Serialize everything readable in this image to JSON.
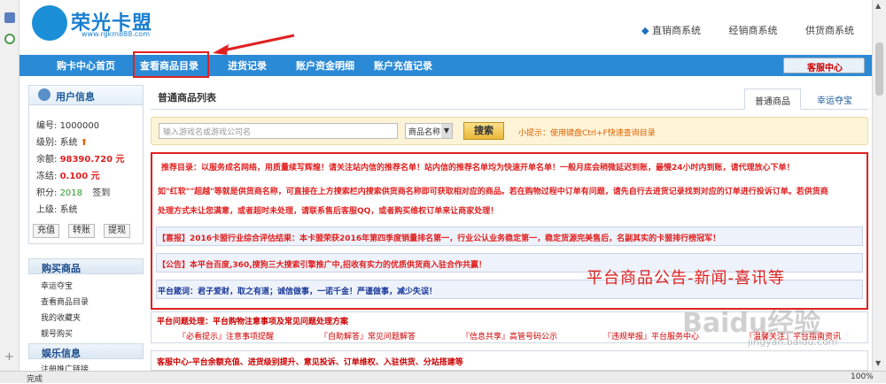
{
  "header": {
    "logo_text": "荣光卡盟",
    "logo_url": "www.rgkm888.com",
    "systems": [
      "直销商系统",
      "经销商系统",
      "供货商系统"
    ]
  },
  "nav": {
    "items": [
      "购卡中心首页",
      "查看商品目录",
      "进货记录",
      "账户资金明细",
      "账户充值记录"
    ],
    "customer_service": "客服中心"
  },
  "user": {
    "title": "用户信息",
    "id_label": "编号:",
    "id_value": "1000000",
    "level_label": "级别:",
    "level_value": "系统",
    "balance_label": "余额:",
    "balance_value": "98390.720 元",
    "frozen_label": "冻结:",
    "frozen_value": "0.100 元",
    "points_label": "积分:",
    "points_value": "2018",
    "checkin": "签到",
    "parent_label": "上级:",
    "parent_value": "系统",
    "buttons": [
      "充值",
      "转账",
      "提现"
    ]
  },
  "buy": {
    "title": "购买商品",
    "items": [
      "幸运夺宝",
      "查看商品目录",
      "我的收藏夹",
      "靓号购买"
    ]
  },
  "entertainment": {
    "title": "娱乐信息",
    "items": [
      "注册推广链接"
    ]
  },
  "content": {
    "list_title": "普通商品列表",
    "tabs": [
      "普通商品",
      "幸运夺宝"
    ],
    "search_placeholder": "输入游戏名或游戏公司名",
    "search_select": "商品名称",
    "search_button": "搜索",
    "search_tip": "小提示：使用键盘Ctrl+F快速查询目录"
  },
  "notice": {
    "line1": "推荐目录：以服务成名网络，用质量续写辉煌！请关注站内信的推荐名单！站内信的推荐名单均为快速开单名单！一般月底会稍微延迟到账，最慢24小时内到账，请代理放心下单！",
    "line2": "如\"红软\"\"超越\"等就是供货商名称，可直接在上方搜索栏内搜索供货商名称即可获取相对应的商品。若在购物过程中订单有问题，请先自行去进货记录找到对应的订单进行投诉订单。若供货商",
    "line3": "处理方式未让您满意，或者超时未处理，请联系售后客服QQ，或者购买维权订单来让商家处理！",
    "xibao": "【喜报】2016卡盟行业综合评估结果：本卡盟荣获2016年第四季度销量排名第一，行业公认业务稳定第一，稳定货源完美售后，名副其实的卡盟排行榜冠军！",
    "gonggao": "【公告】本平台百度,360,搜狗三大搜索引擎推广中,招收有实力的优质供货商入驻合作共赢！",
    "motto": "平台箴词：君子爱财，取之有道；诚信做事，一诺千金！严谨做事，减少失误！",
    "overlay": "平台商品公告-新闻-喜讯等"
  },
  "faq": {
    "title": "平台问题处理：平台购物注意事项及常见问题处理方案",
    "links": [
      "『必看提示』注意事项提醒",
      "『自助解答』常见问题解答",
      "『信息共享』高管号码公示",
      "『违规举报』平台服务中心",
      "『温馨关注』平台指南资讯"
    ]
  },
  "cs_row": "客服中心-平台余额充值、进货级别提升、意见投诉、订单维权、入驻供货、分站搭建等",
  "status": {
    "text": "完成",
    "zoom": "100%"
  },
  "watermark": {
    "brand": "Baidu经验",
    "url": "jingyan.baidu.com"
  }
}
